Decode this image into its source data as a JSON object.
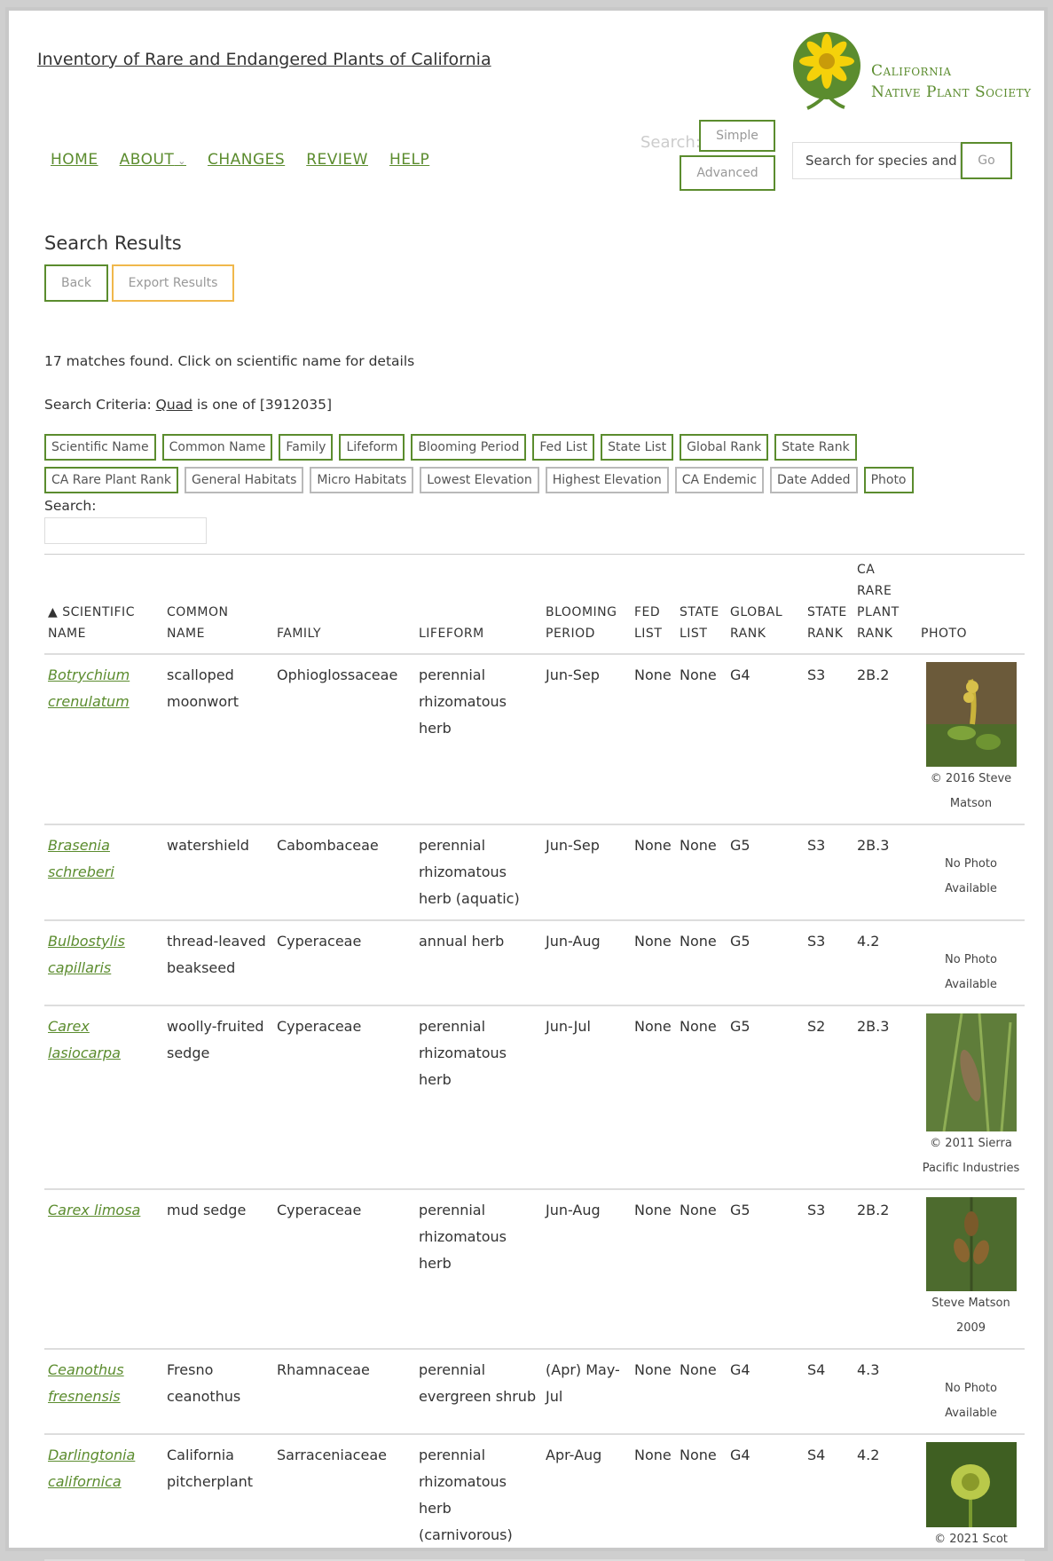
{
  "header": {
    "title": "Inventory of Rare and Endangered Plants of California",
    "logo_line1": "California",
    "logo_line2": "Native Plant Society"
  },
  "nav": {
    "home": "HOME",
    "about": "ABOUT",
    "changes": "CHANGES",
    "review": "REVIEW",
    "help": "HELP"
  },
  "search": {
    "label": "Search:",
    "simple": "Simple",
    "advanced": "Advanced",
    "input_value": "Search for species and",
    "go": "Go"
  },
  "results": {
    "heading": "Search Results",
    "back": "Back",
    "export": "Export Results",
    "matches": "17 matches found. Click on scientific name for details",
    "criteria_prefix": "Search Criteria: ",
    "criteria_field": "Quad",
    "criteria_rest": " is one of [3912035]",
    "table_search_label": "Search:"
  },
  "column_toggles": [
    {
      "label": "Scientific Name",
      "on": true
    },
    {
      "label": "Common Name",
      "on": true
    },
    {
      "label": "Family",
      "on": true
    },
    {
      "label": "Lifeform",
      "on": true
    },
    {
      "label": "Blooming Period",
      "on": true
    },
    {
      "label": "Fed List",
      "on": true
    },
    {
      "label": "State List",
      "on": true
    },
    {
      "label": "Global Rank",
      "on": true
    },
    {
      "label": "State Rank",
      "on": true
    },
    {
      "label": "CA Rare Plant Rank",
      "on": true
    },
    {
      "label": "General Habitats",
      "on": false
    },
    {
      "label": "Micro Habitats",
      "on": false
    },
    {
      "label": "Lowest Elevation",
      "on": false
    },
    {
      "label": "Highest Elevation",
      "on": false
    },
    {
      "label": "CA Endemic",
      "on": false
    },
    {
      "label": "Date Added",
      "on": false
    },
    {
      "label": "Photo",
      "on": true
    }
  ],
  "table": {
    "headers": [
      "▲ Scientific Name",
      "Common Name",
      "Family",
      "Lifeform",
      "Blooming Period",
      "Fed List",
      "State List",
      "Global Rank",
      "State Rank",
      "CA Rare Plant Rank",
      "Photo"
    ],
    "rows": [
      {
        "sci": "Botrychium crenulatum",
        "common": "scalloped moonwort",
        "family": "Ophioglossaceae",
        "lifeform": "perennial rhizomatous herb",
        "bloom": "Jun-Sep",
        "fed": "None",
        "state": "None",
        "grank": "G4",
        "srank": "S3",
        "crpr": "2B.2",
        "photo_credit": "© 2016 Steve Matson",
        "photo": "moonwort"
      },
      {
        "sci": "Brasenia schreberi",
        "common": "watershield",
        "family": "Cabombaceae",
        "lifeform": "perennial rhizomatous herb (aquatic)",
        "bloom": "Jun-Sep",
        "fed": "None",
        "state": "None",
        "grank": "G5",
        "srank": "S3",
        "crpr": "2B.3",
        "photo_credit": "No Photo Available",
        "photo": ""
      },
      {
        "sci": "Bulbostylis capillaris",
        "common": "thread-leaved beakseed",
        "family": "Cyperaceae",
        "lifeform": "annual herb",
        "bloom": "Jun-Aug",
        "fed": "None",
        "state": "None",
        "grank": "G5",
        "srank": "S3",
        "crpr": "4.2",
        "photo_credit": "No Photo Available",
        "photo": ""
      },
      {
        "sci": "Carex lasiocarpa",
        "common": "woolly-fruited sedge",
        "family": "Cyperaceae",
        "lifeform": "perennial rhizomatous herb",
        "bloom": "Jun-Jul",
        "fed": "None",
        "state": "None",
        "grank": "G5",
        "srank": "S2",
        "crpr": "2B.3",
        "photo_credit": "© 2011 Sierra Pacific Industries",
        "photo": "sedge"
      },
      {
        "sci": "Carex limosa",
        "common": "mud sedge",
        "family": "Cyperaceae",
        "lifeform": "perennial rhizomatous herb",
        "bloom": "Jun-Aug",
        "fed": "None",
        "state": "None",
        "grank": "G5",
        "srank": "S3",
        "crpr": "2B.2",
        "photo_credit": "Steve Matson 2009",
        "photo": "mudsedge"
      },
      {
        "sci": "Ceanothus fresnensis",
        "common": "Fresno ceanothus",
        "family": "Rhamnaceae",
        "lifeform": "perennial evergreen shrub",
        "bloom": "(Apr) May-Jul",
        "fed": "None",
        "state": "None",
        "grank": "G4",
        "srank": "S4",
        "crpr": "4.3",
        "photo_credit": "No Photo Available",
        "photo": ""
      },
      {
        "sci": "Darlingtonia californica",
        "common": "California pitcherplant",
        "family": "Sarraceniaceae",
        "lifeform": "perennial rhizomatous herb (carnivorous)",
        "bloom": "Apr-Aug",
        "fed": "None",
        "state": "None",
        "grank": "G4",
        "srank": "S4",
        "crpr": "4.2",
        "photo_credit": "© 2021 Scot",
        "photo": "pitcher"
      }
    ]
  },
  "colors": {
    "accent": "#5b8c2e",
    "export": "#f0b84c"
  }
}
